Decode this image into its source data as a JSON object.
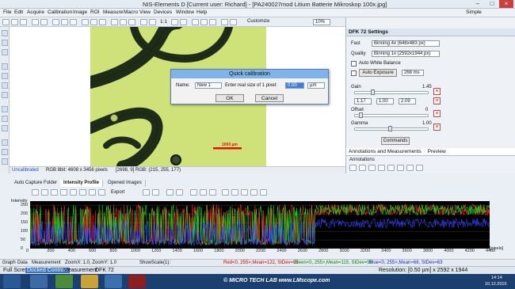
{
  "window": {
    "title": "NIS-Elements D [Current user: Richard]  - [PA240027mod Litium Batterie Mikroskop 100x.jpg]"
  },
  "menu": [
    "File",
    "Edit",
    "Acquire",
    "Calibration",
    "Image",
    "ROI",
    "Measure",
    "Macro",
    "View",
    "Devices",
    "Window",
    "Help"
  ],
  "search": {
    "placeholder": "Simple"
  },
  "toolbar": {
    "zoom": "10%",
    "scale": "1:1",
    "customize": "Customize"
  },
  "image": {
    "scalebar_label": "1000 µm"
  },
  "status_image": {
    "calibration": "Uncalibrated",
    "info": "RGB 8bit: 4608 x 3456 pixels",
    "pixel": "[2698, 9] RGB: (215, 255, 177)"
  },
  "dialog": {
    "title": "Quick calibration",
    "name_label": "Name:",
    "name_value": "New 1",
    "size_label": "Enter real size of 1 pixel:",
    "size_value": "0.00",
    "unit": "µm",
    "ok": "OK",
    "cancel": "Cancel"
  },
  "camera": {
    "header": "DFK 72 Settings",
    "fast_label": "Fast",
    "fast_value": "Binning 4x (648x483 px)",
    "quality_label": "Quality",
    "quality_value": "Binning 1x (2592x1944 px)",
    "awb": "Auto White Balance",
    "auto_exposure": "Auto Exposure",
    "exposure_value": "268 ms",
    "gain_label": "Gain",
    "gain_value": "1.45",
    "rgb": [
      "1.17",
      "1.00",
      "2.09"
    ],
    "offset_label": "Offset",
    "offset_value": "0",
    "gamma_label": "Gamma",
    "gamma_value": "1.00",
    "commands": "Commands"
  },
  "annotations": {
    "tab": "Annotations and Measurements",
    "preview": "Preview",
    "section": "Annotations"
  },
  "graph_tabs": [
    "Auto Capture Folder",
    "Intensity Profile",
    "Opened Images"
  ],
  "graph_toolbar": {
    "export": "Export"
  },
  "chart_data": {
    "type": "line",
    "ylabel": "Intensity",
    "xlabel": "[pixels]",
    "xlim": [
      0,
      4400
    ],
    "ylim": [
      0,
      275
    ],
    "xticks": [
      0,
      200,
      400,
      600,
      800,
      1000,
      1200,
      1400,
      1600,
      1800,
      2000,
      2200,
      2400,
      2600,
      2800,
      3000,
      3200,
      3400,
      3600,
      3800,
      4000,
      4200,
      4400
    ],
    "yticks": [
      0,
      50,
      100,
      150,
      200,
      250
    ],
    "series": [
      {
        "name": "Red",
        "color": "#ff2020"
      },
      {
        "name": "Green",
        "color": "#20e020"
      },
      {
        "name": "Blue",
        "color": "#3040ff"
      }
    ],
    "stats": {
      "red": "Red<0, 255>,Mean=122, StDev=95",
      "green": "Green<0, 255>,Mean=115, StDev=99",
      "blue": "Blue<0, 255>,Mean=68, StDev=63"
    }
  },
  "graph_status": {
    "tabs": [
      "Graph",
      "Data",
      "Measurement"
    ],
    "zoom": "ZoomX: 1.0, ZoomY: 1.0",
    "showscale": "ShowScale(1):"
  },
  "bottom_tabs": [
    "Full Screen",
    "Docked Controls",
    "Measurement",
    "DFK 72"
  ],
  "bottom_right": {
    "resolution": "Resolution: [0.50 µm] x 2592 x 1944"
  },
  "taskbar": {
    "time": "14:14",
    "date": "10.12.2015"
  },
  "watermark": "© MICRO TECH LAB   www.LMscope.com"
}
